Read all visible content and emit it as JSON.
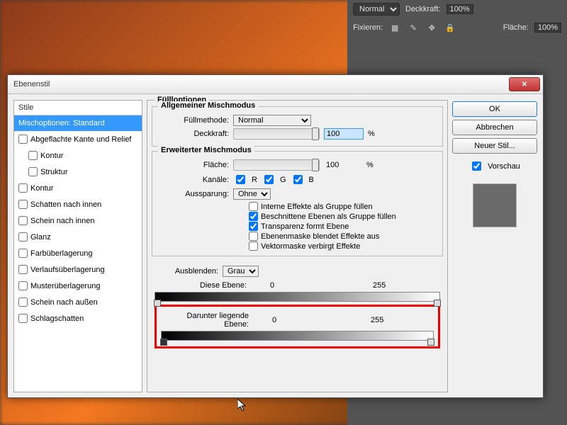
{
  "panel": {
    "blend": "Normal",
    "opacity": "100%",
    "fill": "100%",
    "deckkraft": "Deckkraft:",
    "flache": "Fläche:",
    "fixieren": "Fixieren:"
  },
  "dialog": {
    "title": "Ebenenstil"
  },
  "styles": {
    "header": "Stile",
    "items": [
      {
        "label": "Mischoptionen: Standard",
        "selected": true,
        "checkbox": false
      },
      {
        "label": "Abgeflachte Kante und Relief",
        "checkbox": true
      },
      {
        "label": "Kontur",
        "checkbox": true,
        "indent": true
      },
      {
        "label": "Struktur",
        "checkbox": true,
        "indent": true
      },
      {
        "label": "Kontur",
        "checkbox": true
      },
      {
        "label": "Schatten nach innen",
        "checkbox": true
      },
      {
        "label": "Schein nach innen",
        "checkbox": true
      },
      {
        "label": "Glanz",
        "checkbox": true
      },
      {
        "label": "Farbüberlagerung",
        "checkbox": true
      },
      {
        "label": "Verlaufsüberlagerung",
        "checkbox": true
      },
      {
        "label": "Musterüberlagerung",
        "checkbox": true
      },
      {
        "label": "Schein nach außen",
        "checkbox": true
      },
      {
        "label": "Schlagschatten",
        "checkbox": true
      }
    ]
  },
  "center": {
    "title": "Füllloptionen",
    "g1": "Allgemeiner Mischmodus",
    "g2": "Erweiterter Mischmodus",
    "fullmethode": "Füllmethode:",
    "normal": "Normal",
    "deckkraft": "Deckkraft:",
    "opVal": "100",
    "pct": "%",
    "flache": "Fläche:",
    "flVal": "100",
    "kanale": "Kanäle:",
    "r": "R",
    "g": "G",
    "b": "B",
    "aussparung": "Aussparung:",
    "ohne": "Ohne",
    "cb1": "Interne Effekte als Gruppe füllen",
    "cb2": "Beschnittene Ebenen als Gruppe füllen",
    "cb3": "Transparenz formt Ebene",
    "cb4": "Ebenenmaske blendet Effekte aus",
    "cb5": "Vektormaske verbirgt Effekte",
    "ausblenden": "Ausblenden:",
    "grau": "Grau",
    "diese": "Diese Ebene:",
    "darunter": "Darunter liegende Ebene:",
    "v0": "0",
    "v255": "255"
  },
  "btns": {
    "ok": "OK",
    "cancel": "Abbrechen",
    "new": "Neuer Stil...",
    "preview": "Vorschau"
  }
}
